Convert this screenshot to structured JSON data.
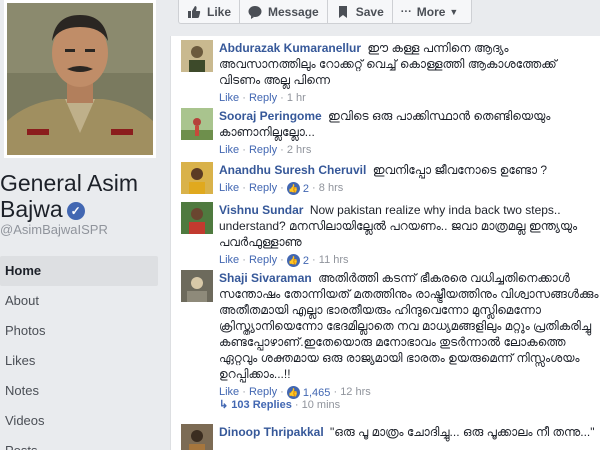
{
  "page": {
    "name_line1": "General Asim",
    "name_line2": "Bajwa",
    "handle": "@AsimBajwaISPR"
  },
  "nav": {
    "items": [
      {
        "label": "Home",
        "active": true
      },
      {
        "label": "About"
      },
      {
        "label": "Photos"
      },
      {
        "label": "Likes"
      },
      {
        "label": "Notes"
      },
      {
        "label": "Videos"
      },
      {
        "label": "Posts"
      }
    ]
  },
  "actions": {
    "like": "Like",
    "message": "Message",
    "save": "Save",
    "more": "More"
  },
  "comments": [
    {
      "name": "Abdurazak Kumaranellur",
      "text": "ഈ കള്ള പന്നിനെ ആദ്യം അവസാനത്തിലും റോക്കറ്റ് വെച്ച് കൊള്ളത്തി ആകാശത്തേക്ക് വിടണം അല്ല പിന്നെ",
      "like": "Like",
      "reply": "Reply",
      "time": "1 hr",
      "avatar_color": "#b9a887"
    },
    {
      "name": "Sooraj Peringome",
      "text": "ഇവിടെ ഒരു പാക്കിസ്ഥാൻ തെണ്ടിയെയും കാണാനില്ലല്ലോ...",
      "like": "Like",
      "reply": "Reply",
      "time": "2 hrs",
      "avatar_color": "#8fae7a"
    },
    {
      "name": "Anandhu Suresh Cheruvil",
      "text": "ഇവനിപ്പോ ജീവനോടെ ഉണ്ടോ ?",
      "like": "Like",
      "reply": "Reply",
      "reactions": "2",
      "time": "8 hrs",
      "avatar_color": "#c9a23a"
    },
    {
      "name": "Vishnu Sundar",
      "text": "Now pakistan realize why inda back two steps.. understand? മനസിലായില്ലേൽ പറയണം.. ജവാ മാത്രമല്ല ഇന്ത്യയും പവർഫുള്ളാണു",
      "like": "Like",
      "reply": "Reply",
      "reactions": "2",
      "time": "11 hrs",
      "avatar_color": "#5a8b4b"
    },
    {
      "name": "Shaji Sivaraman",
      "text": "അതിർത്തി കടന്ന് ഭീകരരെ വധിച്ചതിനെക്കാൾ സന്തോഷം തോന്നിയത് മതത്തിനും രാഷ്ട്രീയത്തിനും വിശ്വാസങ്ങൾക്കും അതീതമായി എല്ലാ ഭാരതീയരും ഹിന്ദുവെന്നോ മുസ്ലിമെന്നോ ക്രിസ്ത്യാനിയെന്നോ ഭേദമില്ലാതെ നവ മാധ്യമങ്ങളിലും മറ്റും പ്രതികരിച്ചു കണ്ടപ്പോഴാണ്.ഇതേയൊരു മനോഭാവം തുടർന്നാൽ ലോകത്തെ ഏറ്റവും ശക്തമായ ഒരു രാജ്യമായി ഭാരതം ഉയരുമെന്ന് നിസ്സംശയം ഉറപ്പിക്കാം...!!",
      "like": "Like",
      "reply": "Reply",
      "reactions": "1,465",
      "time": "12 hrs",
      "avatar_color": "#6d6a5c",
      "replies_label": "103 Replies",
      "replies_time": "10 mins"
    },
    {
      "name": "Dinoop Thripakkal",
      "text": "\"ഒരു പൂ മാത്രം ചോദിച്ചു... ഒരു പൂക്കാലം നീ തന്നു...\"",
      "avatar_color": "#7c6b54"
    }
  ]
}
